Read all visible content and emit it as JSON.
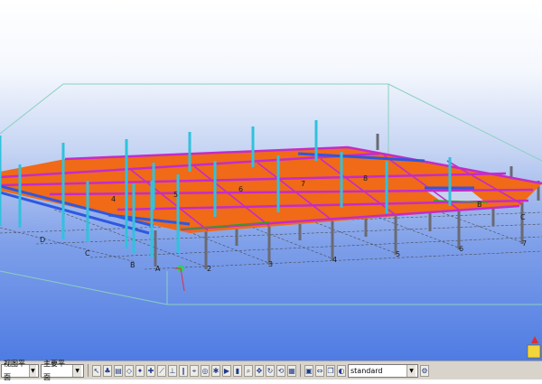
{
  "viewport": {
    "grid_labels_numbers": [
      "4",
      "5",
      "6",
      "7",
      "8"
    ],
    "grid_labels_letters": [
      "D",
      "C",
      "B",
      "A",
      "B",
      "C"
    ],
    "axis_labels": [
      "2",
      "3",
      "4",
      "5",
      "6",
      "7"
    ]
  },
  "toolbar": {
    "view_plane_select": "视图平面",
    "work_plane_select": "主要平面",
    "filter_select": "standard",
    "tool_icons": [
      "select-icon",
      "tree-icon",
      "layer-icon",
      "snap-end-icon",
      "snap-mid-icon",
      "snap-node-icon",
      "snap-line-icon",
      "snap-perp-icon",
      "snap-ext-icon",
      "snap-ref-icon",
      "snap-geom-icon",
      "snap-any-icon",
      "play-icon",
      "pause-icon",
      "zoom-icon",
      "pan-icon",
      "rotate-icon",
      "orbit-icon",
      "grid-icon",
      "part-icon",
      "measure-icon",
      "copy-icon",
      "view-icon",
      "settings-icon"
    ]
  },
  "colors": {
    "slab": "#f06a18",
    "beam_magenta": "#c42cc8",
    "beam_blue": "#2e58e0",
    "column_cyan": "#30c2dc",
    "column_grey": "#6a6a72",
    "box_outline": "#8ad0c0"
  }
}
